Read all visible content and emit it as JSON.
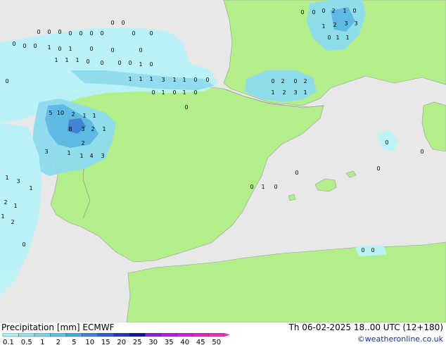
{
  "legend": {
    "title": "Precipitation [mm]",
    "model": "ECMWF",
    "datetime": "Th 06-02-2025 18..00 UTC (12+180)",
    "credit": "©weatheronline.co.uk",
    "scale_labels": [
      "0.1",
      "0.5",
      "1",
      "2",
      "5",
      "10",
      "15",
      "20",
      "25",
      "30",
      "35",
      "40",
      "45",
      "50"
    ],
    "scale_colors": [
      "#a5f0f5",
      "#8fe3f0",
      "#78d4ec",
      "#5ec2e8",
      "#46a8e0",
      "#3a86d8",
      "#2f5fcf",
      "#1f3ab8",
      "#0a1a8e",
      "#8a1ee0",
      "#b21ee6",
      "#d21ed6",
      "#e61ec8",
      "#f02ac0"
    ]
  },
  "map": {
    "land_color": "#b3ee8a",
    "sea_color": "#e8e8e8",
    "precip_colors": {
      "light": "#b9f3f8",
      "medium": "#8edcf0",
      "heavy": "#5bb8e8",
      "max": "#3d7fda"
    },
    "station_values": {
      "bay_of_biscay_row1": [
        "0",
        "0",
        "0",
        "0",
        "0",
        "0",
        "0",
        "0",
        "0",
        "0",
        "0"
      ],
      "bay_of_biscay_row2": [
        "0",
        "0",
        "0",
        "1",
        "0",
        "1",
        "0",
        "0",
        "0"
      ],
      "bay_of_biscay_row3": [
        "1",
        "1",
        "1",
        "0",
        "0",
        "0",
        "0",
        "1",
        "0"
      ],
      "north_coast": [
        "1",
        "1",
        "1",
        "3",
        "1",
        "1",
        "0",
        "0",
        "0"
      ],
      "cantabria": [
        "0",
        "1",
        "0",
        "1",
        "0",
        "0"
      ],
      "galicia": [
        "5",
        "10",
        "2",
        "1",
        "1",
        "8",
        "3",
        "2",
        "1",
        "3",
        "1",
        "1",
        "4",
        "3",
        "2"
      ],
      "portugal_coast": [
        "1",
        "3",
        "1",
        "2",
        "1",
        "1",
        "2",
        "0"
      ],
      "pyrenees": [
        "0",
        "2",
        "0",
        "2",
        "1",
        "2",
        "3",
        "1"
      ],
      "alps": [
        "0",
        "0",
        "0",
        "2",
        "1",
        "0",
        "1",
        "2",
        "3",
        "3",
        "0",
        "1",
        "1"
      ],
      "mediterranean": [
        "0",
        "1",
        "0",
        "0",
        "0",
        "0",
        "0",
        "0",
        "0"
      ]
    }
  }
}
